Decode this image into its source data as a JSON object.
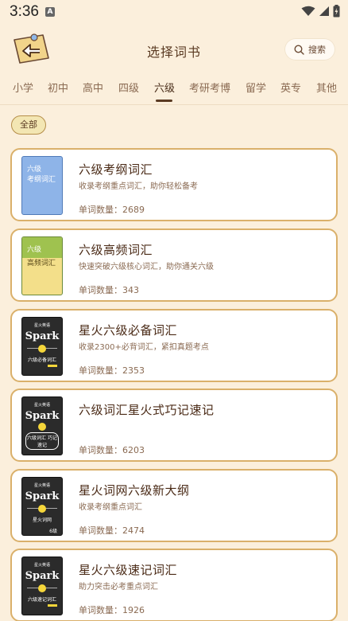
{
  "status": {
    "time": "3:36",
    "notification_letter": "A"
  },
  "header": {
    "title": "选择词书",
    "search_label": "搜索"
  },
  "tabs": [
    {
      "label": "小学",
      "active": false
    },
    {
      "label": "初中",
      "active": false
    },
    {
      "label": "高中",
      "active": false
    },
    {
      "label": "四级",
      "active": false
    },
    {
      "label": "六级",
      "active": true
    },
    {
      "label": "考研考博",
      "active": false
    },
    {
      "label": "留学",
      "active": false
    },
    {
      "label": "英专",
      "active": false
    },
    {
      "label": "其他",
      "active": false
    }
  ],
  "filter": {
    "chip_label": "全部"
  },
  "books": [
    {
      "name": "六级考纲词汇",
      "desc": "收录考纲重点词汇，助你轻松备考",
      "count": "单词数量：2689",
      "cover_lines": [
        "六级",
        "考纲词汇"
      ]
    },
    {
      "name": "六级高频词汇",
      "desc": "快速突破六级核心词汇，助你通关六级",
      "count": "单词数量：343",
      "cover_lines": [
        "六级",
        "高频词汇"
      ]
    },
    {
      "name": "星火六级必备词汇",
      "desc": "收录2300+必背词汇，紧扣真题考点",
      "count": "单词数量：2353",
      "cover_lines": [
        "星火英语",
        "Spark",
        "六级必备词汇"
      ]
    },
    {
      "name": "六级词汇星火式巧记速记",
      "desc": "",
      "count": "单词数量：6203",
      "cover_lines": [
        "星火英语",
        "Spark",
        "六级词汇 巧记速记"
      ]
    },
    {
      "name": "星火词网六级新大纲",
      "desc": "收录考纲重点词汇",
      "count": "单词数量：2474",
      "cover_lines": [
        "星火英语",
        "Spark",
        "星火词网",
        "6级"
      ]
    },
    {
      "name": "星火六级速记词汇",
      "desc": "助力突击必考重点词汇",
      "count": "单词数量：1926",
      "cover_lines": [
        "星火英语",
        "Spark",
        "六级速记词汇"
      ]
    }
  ],
  "colors": {
    "background": "#fbefdc",
    "card_border": "#dab06a",
    "title_text": "#5a3a22"
  }
}
